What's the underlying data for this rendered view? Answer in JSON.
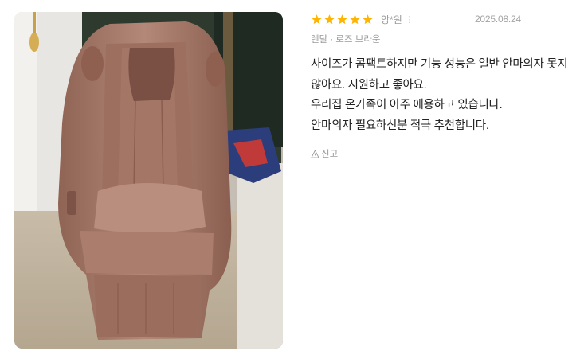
{
  "rating": {
    "stars": 5,
    "max": 5,
    "color": "#ffb400"
  },
  "review": {
    "author": "앙*원",
    "more_label": "⋮",
    "date": "2025.08.24",
    "option": "렌탈 · 로즈 브라운",
    "body_lines": [
      "사이즈가 콤팩트하지만 기능 성능은 일반 안마의자 못지",
      "않아요. 시원하고 좋아요.",
      "우리집 온가족이 아주 애용하고 있습니다.",
      "안마의자 필요하신분 적극 추천합니다."
    ],
    "report_label": "신고"
  },
  "photo": {
    "description_icon": "massage-chair-photo"
  }
}
